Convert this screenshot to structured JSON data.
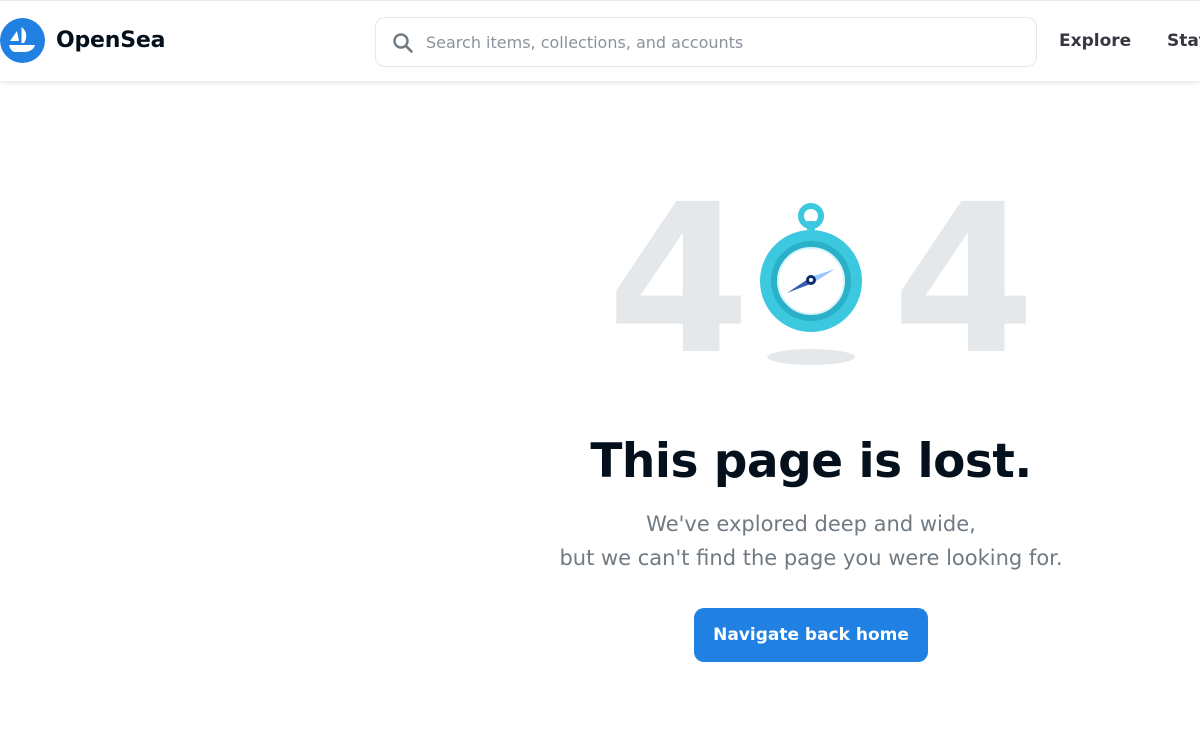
{
  "header": {
    "brand_name": "OpenSea",
    "search": {
      "placeholder": "Search items, collections, and accounts",
      "value": ""
    },
    "nav": [
      {
        "label": "Explore"
      },
      {
        "label": "Stat"
      }
    ]
  },
  "error": {
    "digit_left": "4",
    "digit_right": "4",
    "title": "This page is lost.",
    "message_line1": "We've explored deep and wide,",
    "message_line2": "but we can't find the page you were looking for.",
    "button_label": "Navigate back home"
  },
  "icons": {
    "logo": "opensea-ship-logo-icon",
    "search": "search-icon",
    "illustration": "compass-icon"
  },
  "colors": {
    "brand_blue": "#2081e2",
    "heading": "#04111d",
    "muted_text": "#707a83",
    "digit_gray": "#e5e8eb",
    "compass_teal": "#3cc8df"
  }
}
